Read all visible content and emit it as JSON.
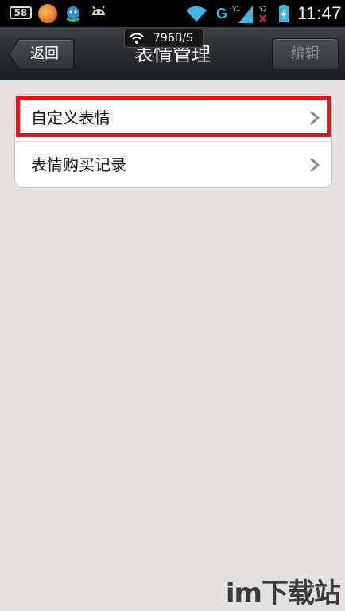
{
  "status_bar": {
    "app_icon_label": "58",
    "network_type": "G",
    "time": "11:47",
    "net_speed": "796B/S"
  },
  "header": {
    "back_label": "返回",
    "title": "表情管理",
    "edit_label": "编辑"
  },
  "list": {
    "items": [
      {
        "label": "自定义表情",
        "highlighted": true
      },
      {
        "label": "表情购买记录",
        "highlighted": false
      }
    ]
  },
  "watermark": {
    "text": "im下载站"
  },
  "colors": {
    "highlight": "#e3141d",
    "background": "#e3e2e0",
    "network": "#3fb6e8"
  }
}
